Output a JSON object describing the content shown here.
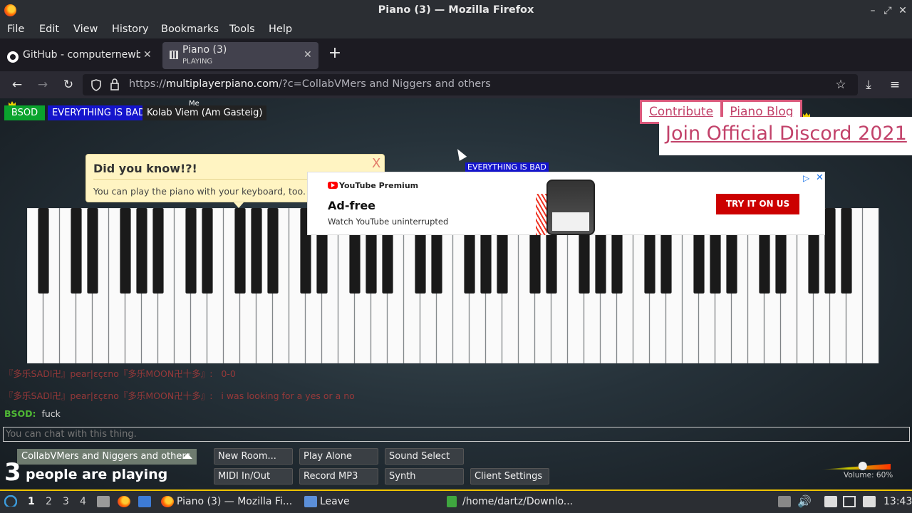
{
  "window": {
    "title": "Piano (3) — Mozilla Firefox"
  },
  "menu": [
    "File",
    "Edit",
    "View",
    "History",
    "Bookmarks",
    "Tools",
    "Help"
  ],
  "tabs": [
    {
      "title": "GitHub - computernewb/",
      "sub": ""
    },
    {
      "title": "Piano (3)",
      "sub": "PLAYING"
    }
  ],
  "url": {
    "prefix": "https://",
    "host": "multiplayerpiano.com",
    "path": "/?c=CollabVMers and Niggers and others"
  },
  "page": {
    "users": [
      {
        "name": "BSOD",
        "color": "#0aa32d"
      },
      {
        "name": "EVERYTHING IS BAD",
        "color": "#1414cc"
      },
      {
        "name": "Kolab Viem (Am Gasteig)",
        "color": "#222222"
      }
    ],
    "me_label": "Me",
    "links": {
      "contribute": "Contribute",
      "blog": "Piano Blog",
      "discord": "Join Official Discord 2021"
    },
    "floating_name": "EVERYTHING IS BAD",
    "notice": {
      "title": "Did you know!?!",
      "body": "You can play the piano with your keyboard, too. Tr",
      "close": "X"
    },
    "ad": {
      "brand": "YouTube Premium",
      "headline": "Ad-free",
      "sub": "Watch YouTube uninterrupted",
      "cta": "TRY IT ON US"
    },
    "chat": [
      {
        "name": "『多乐SADl卍』pear|ɛçɛno『多乐MOON卍十多』",
        "text": "0-0"
      },
      {
        "name": "『多乐SADl卍』pear|ɛçɛno『多乐MOON卍十多』",
        "text": "i was looking for a yes or a no"
      },
      {
        "name": "BSOD:",
        "text": "fuck"
      }
    ],
    "chat_placeholder": "You can chat with this thing.",
    "room": "CollabVMers and Niggers and others",
    "player_count": "3",
    "player_label": "people are playing",
    "buttons": {
      "new_room": "New Room...",
      "play_alone": "Play Alone",
      "sound_select": "Sound Select",
      "midi": "MIDI In/Out",
      "record": "Record MP3",
      "synth": "Synth",
      "client_settings": "Client Settings"
    },
    "volume_label": "Volume: 60%",
    "volume_level": 0.6
  },
  "taskbar": {
    "workspaces": [
      "1",
      "2",
      "3",
      "4"
    ],
    "windows": [
      "Piano (3) — Mozilla Fi...",
      "Leave",
      "/home/dartz/Downlo..."
    ],
    "clock": "13:43"
  }
}
